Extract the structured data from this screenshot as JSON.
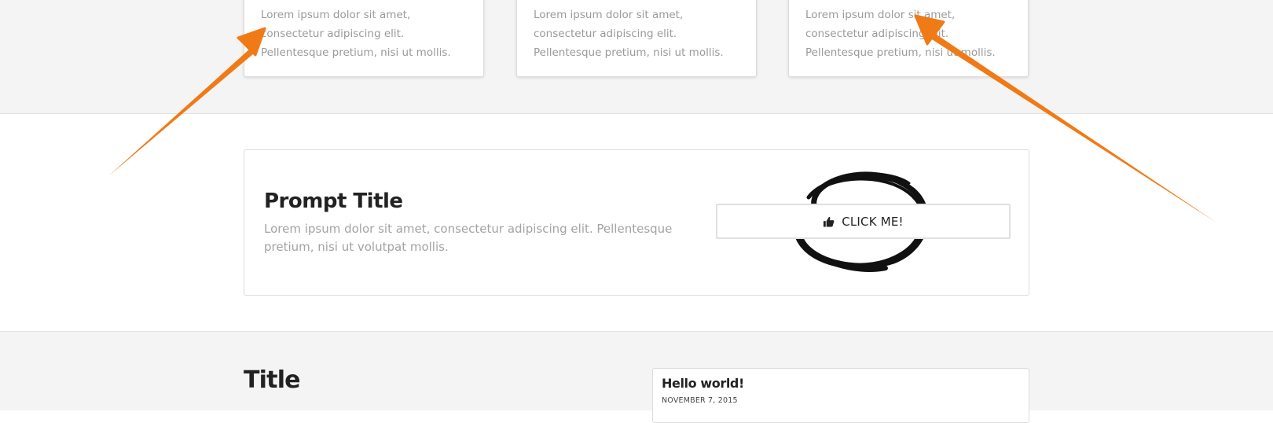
{
  "feature_cards": [
    {
      "text": "Lorem ipsum dolor sit amet, consectetur adipiscing elit. Pellentesque pretium, nisi ut mollis."
    },
    {
      "text": "Lorem ipsum dolor sit amet, consectetur adipiscing elit. Pellentesque pretium, nisi ut mollis."
    },
    {
      "text": "Lorem ipsum dolor sit amet, consectetur adipiscing elit. Pellentesque pretium, nisi ut mollis."
    }
  ],
  "prompt": {
    "title": "Prompt Title",
    "text": "Lorem ipsum dolor sit amet, consectetur adipiscing elit. Pellentesque pretium, nisi ut volutpat mollis.",
    "button_label": "CLICK ME!",
    "button_icon": "thumbs-up-icon"
  },
  "blog_section": {
    "title": "Title",
    "post": {
      "title": "Hello world!",
      "date": "NOVEMBER 7, 2015"
    }
  },
  "colors": {
    "annotation_arrow": "#f07a16",
    "band_background": "#f4f4f4",
    "muted_text": "#9a9a9a"
  }
}
